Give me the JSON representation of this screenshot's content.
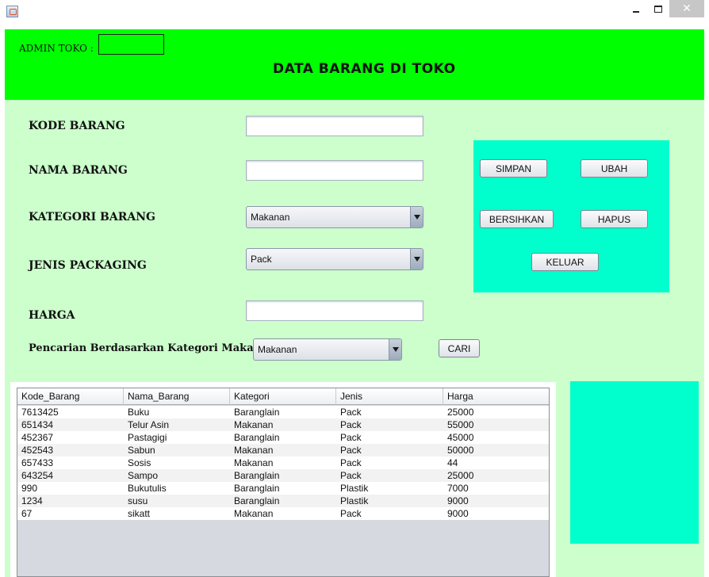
{
  "window": {
    "icon": "java-app-icon",
    "controls": [
      "minimize-icon",
      "maximize-icon",
      "close-icon"
    ],
    "close_glyph": "✕"
  },
  "header": {
    "admin_label": "ADMIN TOKO :",
    "admin_value": "",
    "title": "DATA BARANG DI TOKO",
    "bg_color": "#00ff00"
  },
  "form": {
    "kode_label": "KODE BARANG",
    "kode_value": "",
    "nama_label": "NAMA BARANG",
    "nama_value": "",
    "kategori_label": "KATEGORI BARANG",
    "kategori_value": "Makanan",
    "jenis_label": "JENIS PACKAGING",
    "jenis_value": "Pack",
    "harga_label": "HARGA",
    "harga_value": "",
    "search_label": "Pencarian Berdasarkan Kategori Makanan",
    "search_value": "Makanan",
    "search_button": "CARI",
    "bg_color": "#ccffcc"
  },
  "buttons": {
    "simpan": "SIMPAN",
    "ubah": "UBAH",
    "bersihkan": "BERSIHKAN",
    "hapus": "HAPUS",
    "keluar": "KELUAR",
    "panel_color": "#00ffcc"
  },
  "table": {
    "columns": [
      "Kode_Barang",
      "Nama_Barang",
      "Kategori",
      "Jenis",
      "Harga"
    ],
    "rows": [
      [
        "7613425",
        "Buku",
        "Baranglain",
        "Pack",
        "25000"
      ],
      [
        "651434",
        "Telur Asin",
        "Makanan",
        "Pack",
        "55000"
      ],
      [
        "452367",
        "Pastagigi",
        "Baranglain",
        "Pack",
        "45000"
      ],
      [
        "452543",
        "Sabun",
        "Makanan",
        "Pack",
        "50000"
      ],
      [
        "657433",
        "Sosis",
        "Makanan",
        "Pack",
        "44"
      ],
      [
        "643254",
        "Sampo",
        "Baranglain",
        "Pack",
        "25000"
      ],
      [
        "990",
        "Bukutulis",
        "Baranglain",
        "Plastik",
        "7000"
      ],
      [
        "1234",
        "susu",
        "Baranglain",
        "Plastik",
        "9000"
      ],
      [
        "67",
        "sikatt",
        "Makanan",
        "Pack",
        "9000"
      ]
    ]
  }
}
